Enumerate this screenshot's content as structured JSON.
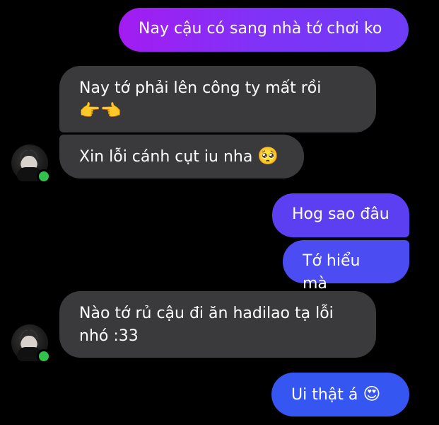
{
  "conversation": {
    "messages": [
      {
        "side": "sent",
        "text": "Nay cậu có sang nhà tớ chơi ko",
        "emoji": ""
      },
      {
        "side": "received",
        "text": "Nay tớ phải lên công ty mất rồi",
        "emoji": "👉👈"
      },
      {
        "side": "received",
        "text": "Xin lỗi cánh cụt iu nha",
        "emoji": "🥺"
      },
      {
        "side": "sent",
        "text": "Hog sao đâu",
        "emoji": ""
      },
      {
        "side": "sent",
        "text": "Tớ hiểu mà",
        "emoji": ""
      },
      {
        "side": "received",
        "text": "Nào tớ rủ cậu đi ăn hadilao tạ lỗi nhó :33",
        "emoji": ""
      },
      {
        "side": "sent",
        "text": "Ui thật á",
        "emoji": "😍"
      }
    ]
  },
  "colors": {
    "background": "#000000",
    "received_bubble": "#3a3a3c",
    "sent_gradient_top": "#a31cf2",
    "sent_gradient_bottom": "#3556f0",
    "online_dot": "#31c24d"
  },
  "icons": {
    "avatar": "avatar-photo",
    "online_status": "online-dot-icon"
  }
}
